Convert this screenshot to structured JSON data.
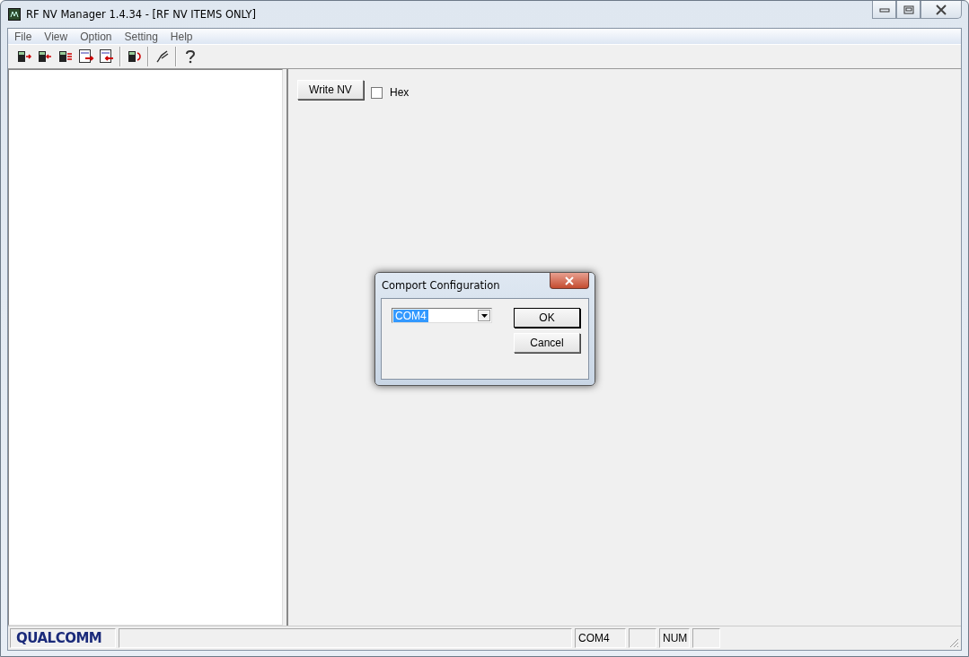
{
  "window": {
    "title": "RF NV Manager 1.4.34 - [RF NV ITEMS ONLY]"
  },
  "menu": [
    "File",
    "View",
    "Option",
    "Setting",
    "Help"
  ],
  "toolbar": [
    {
      "kind": "phone-right"
    },
    {
      "kind": "phone-left"
    },
    {
      "kind": "phone-lines"
    },
    {
      "kind": "doc-right"
    },
    {
      "kind": "doc-left"
    },
    {
      "kind": "sep"
    },
    {
      "kind": "phone-plug"
    },
    {
      "kind": "sep"
    },
    {
      "kind": "cable"
    },
    {
      "kind": "sep"
    },
    {
      "kind": "help"
    }
  ],
  "panel": {
    "write_button": "Write NV",
    "hex": {
      "label": "Hex",
      "checked": false
    }
  },
  "dialog": {
    "title": "Comport Configuration",
    "port": {
      "value": "COM4",
      "selected": true
    },
    "buttons": [
      "OK",
      "Cancel"
    ]
  },
  "status_bar": {
    "logo": "QUALCOMM",
    "port": "COM4",
    "num": "NUM"
  }
}
